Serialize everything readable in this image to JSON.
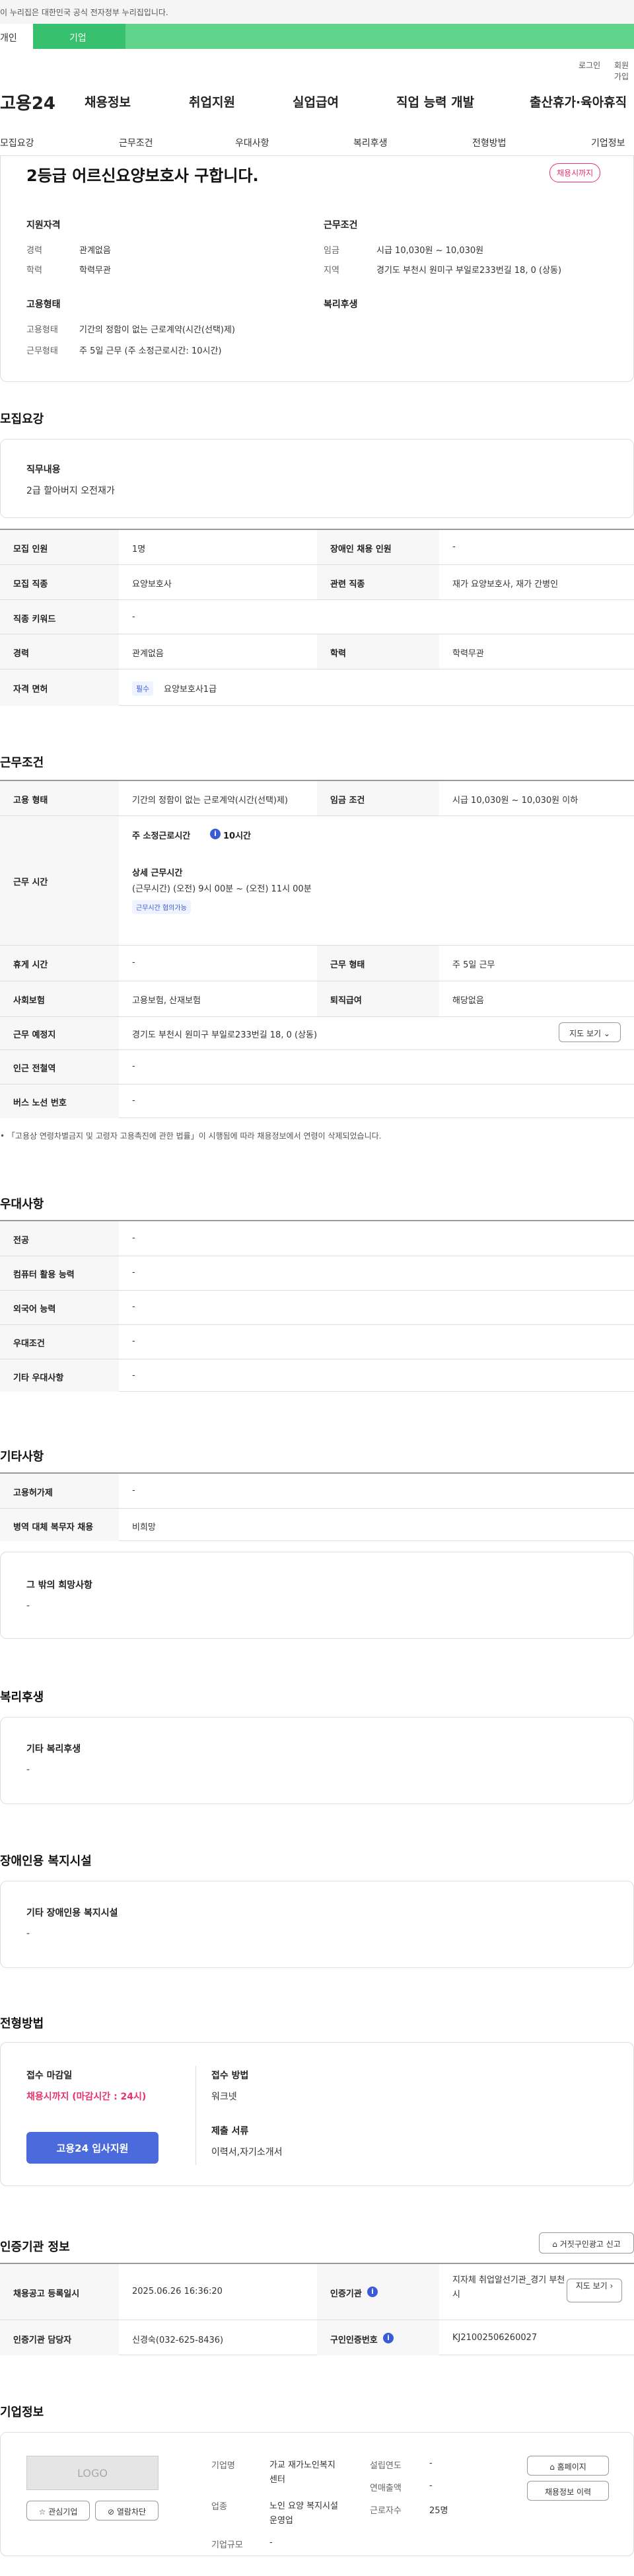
{
  "notice": "이 누리집은 대한민국 공식 전자정부 누리집입니다.",
  "usertabs": {
    "individual": "개인",
    "business": "기업"
  },
  "util": {
    "login": "로그인",
    "join": "회원가입"
  },
  "brand": "고용24",
  "mainnav": [
    "채용정보",
    "취업지원",
    "실업급여",
    "직업 능력 개발",
    "출산휴가·육아휴직"
  ],
  "subnav": [
    "모집요강",
    "근무조건",
    "우대사항",
    "복리후생",
    "전형방법",
    "기업정보"
  ],
  "summary": {
    "title": "2등급 어르신요양보호사 구합니다.",
    "badge": "채용시까지",
    "qual_head": "지원자격",
    "career_label": "경력",
    "career": "관계없음",
    "edu_label": "학력",
    "edu": "학력무관",
    "cond_head": "근무조건",
    "wage_label": "임금",
    "wage": "시급 10,030원 ~ 10,030원",
    "area_label": "지역",
    "area": "경기도 부천시 원미구 부일로233번길 18, 0 (상동)",
    "emp_head": "고용형태",
    "emptype_label": "고용형태",
    "emptype": "기간의 정함이 없는 근로계약(시간(선택)제)",
    "worktype_label": "근무형태",
    "worktype": "주 5일 근무 (주 소정근로시간: 10시간)",
    "welfare_head": "복리후생"
  },
  "recruit": {
    "title": "모집요강",
    "duty_head": "직무내용",
    "duty": "2급 할아버지 오전재가",
    "rows": {
      "count_l": "모집 인원",
      "count": "1명",
      "dis_l": "장애인 채용 인원",
      "dis": "-",
      "job_l": "모집 직종",
      "job": "요양보호사",
      "rel_l": "관련 직종",
      "rel": "재가 요양보호사, 재가 간병인",
      "kw_l": "직종 키워드",
      "kw": "-",
      "car_l": "경력",
      "car": "관계없음",
      "edu_l": "학력",
      "edu": "학력무관",
      "lic_l": "자격 면허",
      "lic_badge": "필수",
      "lic": "요양보호사1급"
    }
  },
  "work": {
    "title": "근무조건",
    "emp_l": "고용 형태",
    "emp": "기간의 정함이 없는 근로계약(시간(선택)제)",
    "wage_l": "임금 조건",
    "wage": "시급 10,030원 ~ 10,030원 이하",
    "time_l": "근무 시간",
    "weekly": "주 소정근로시간",
    "weekly_v": "10시간",
    "detail_head": "상세 근무시간",
    "detail": "(근무시간) (오전) 9시 00분 ~ (오전) 11시 00분",
    "nego": "근무시간 협의가능",
    "rest_l": "휴게 시간",
    "rest": "-",
    "form_l": "근무 형태",
    "form": "주 5일 근무",
    "ins_l": "사회보험",
    "ins": "고용보험, 산재보험",
    "sev_l": "퇴직급여",
    "sev": "해당없음",
    "place_l": "근무 예정지",
    "place": "경기도 부천시 원미구 부일로233번길 18, 0 (상동)",
    "map_btn": "지도 보기",
    "station_l": "인근 전철역",
    "station": "-",
    "bus_l": "버스 노선 번호",
    "bus": "-",
    "footnote": "「고용상 연령차별금지 및 고령자 고용촉진에 관한 법률」이 시행됨에 따라 채용정보에서 연령이 삭제되었습니다."
  },
  "pref": {
    "title": "우대사항",
    "rows": [
      {
        "l": "전공",
        "v": "-"
      },
      {
        "l": "컴퓨터 활용 능력",
        "v": "-"
      },
      {
        "l": "외국어 능력",
        "v": "-"
      },
      {
        "l": "우대조건",
        "v": "-"
      },
      {
        "l": "기타 우대사항",
        "v": "-"
      }
    ]
  },
  "etc": {
    "title": "기타사항",
    "rows": [
      {
        "l": "고용허가제",
        "v": "-"
      },
      {
        "l": "병역 대체 복무자 채용",
        "v": "비희망"
      }
    ],
    "other_head": "그 밖의 희망사항",
    "other": "-"
  },
  "welfare": {
    "title": "복리후생",
    "head": "기타 복리후생",
    "v": "-"
  },
  "disfac": {
    "title": "장애인용 복지시설",
    "head": "기타 장애인용 복지시설",
    "v": "-"
  },
  "select": {
    "title": "전형방법",
    "deadline_l": "접수 마감일",
    "deadline": "채용시까지 (마감시간 : 24시)",
    "apply": "고용24 입사지원",
    "method_l": "접수 방법",
    "method": "워크넷",
    "docs_l": "제출 서류",
    "docs": "이력서,자기소개서"
  },
  "cert": {
    "title": "인증기관 정보",
    "report": "거짓구인광고 신고",
    "reg_l": "채용공고 등록일시",
    "reg": "2025.06.26 16:36:20",
    "org_l": "인증기관",
    "org": "지자체 취업알선기관_경기 부천시",
    "map": "지도 보기",
    "mgr_l": "인증기관 담당자",
    "mgr": "신경숙(032-625-8436)",
    "num_l": "구인인증번호",
    "num": "KJ21002506260027"
  },
  "company": {
    "title": "기업정보",
    "logo": "LOGO",
    "fav": "관심기업",
    "block": "열람차단",
    "name_l": "기업명",
    "name": "가교 재가노인복지센터",
    "ind_l": "업종",
    "ind": "노인 요양 복지시설 운영업",
    "size_l": "기업규모",
    "size": "-",
    "year_l": "설립연도",
    "year": "-",
    "sales_l": "연매출액",
    "sales": "-",
    "emp_l": "근로자수",
    "emp": "25명",
    "home": "홈페이지",
    "history": "채용정보 이력"
  }
}
